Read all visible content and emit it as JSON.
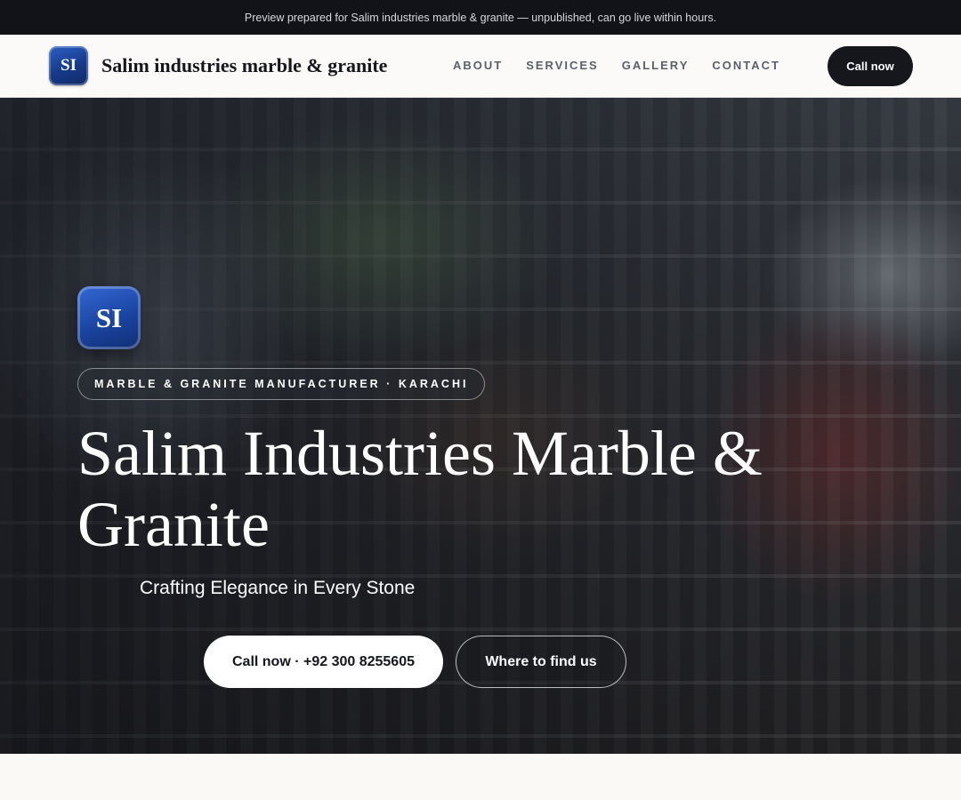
{
  "preview_banner": {
    "text": "Preview prepared for Salim industries marble & granite — unpublished, can go live within hours."
  },
  "header": {
    "logo_initials": "SI",
    "brand_name": "Salim industries marble & granite",
    "nav": [
      "ABOUT",
      "SERVICES",
      "GALLERY",
      "CONTACT"
    ],
    "cta_label": "Call now"
  },
  "hero": {
    "logo_initials": "SI",
    "tagline": "MARBLE & GRANITE MANUFACTURER · KARACHI",
    "title": "Salim Industries Marble & Granite",
    "subtitle": "Crafting Elegance in Every Stone",
    "primary_button": "Call now · +92 300 8255605",
    "secondary_button": "Where to find us",
    "background_image": "shop interior with shelves and shopkeeper"
  },
  "colors": {
    "dark": "#111318",
    "brand_blue": "#1a44a0",
    "page_bg": "#faf9f6"
  }
}
